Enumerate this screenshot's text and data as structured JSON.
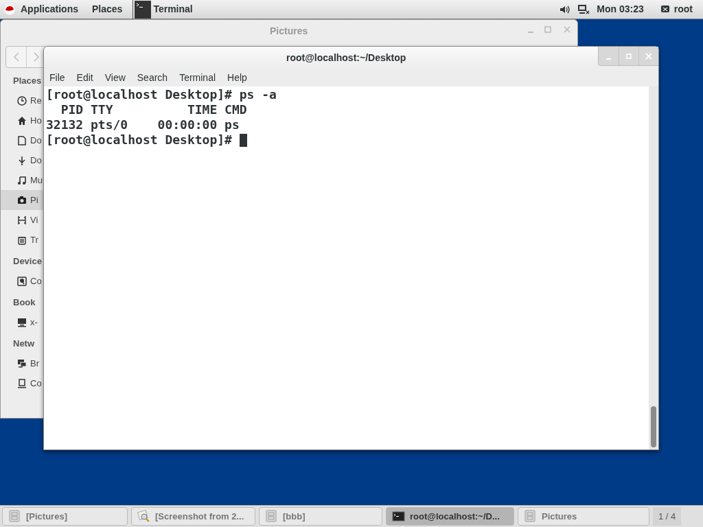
{
  "top_bar": {
    "menus": [
      "Applications",
      "Places"
    ],
    "app": "Terminal",
    "clock": "Mon 03:23",
    "user": "root"
  },
  "file_window": {
    "title": "Pictures",
    "sections": [
      {
        "title": "Places",
        "items": [
          {
            "label": "Re",
            "selected": false
          },
          {
            "label": "Ho",
            "selected": false
          },
          {
            "label": "Do",
            "selected": false
          },
          {
            "label": "Do",
            "selected": false
          },
          {
            "label": "Mu",
            "selected": false
          },
          {
            "label": "Pi",
            "selected": true
          },
          {
            "label": "Vi",
            "selected": false
          },
          {
            "label": "Tr",
            "selected": false
          }
        ]
      },
      {
        "title": "Device",
        "items": [
          {
            "label": "Co",
            "selected": false
          }
        ]
      },
      {
        "title": "Book",
        "items": [
          {
            "label": "x-",
            "selected": false
          }
        ]
      },
      {
        "title": "Netw",
        "items": [
          {
            "label": "Br",
            "selected": false
          },
          {
            "label": "Co",
            "selected": false
          }
        ]
      }
    ]
  },
  "terminal": {
    "title": "root@localhost:~/Desktop",
    "menus": [
      "File",
      "Edit",
      "View",
      "Search",
      "Terminal",
      "Help"
    ],
    "lines": [
      {
        "text": "[root@localhost Desktop]# ps -a",
        "cursor": false
      },
      {
        "text": "  PID TTY          TIME CMD",
        "cursor": false
      },
      {
        "text": "32132 pts/0    00:00:00 ps",
        "cursor": false
      },
      {
        "text": "[root@localhost Desktop]# ",
        "cursor": true
      }
    ]
  },
  "taskbar": {
    "items": [
      {
        "label": "[Pictures]",
        "kind": "folder",
        "selected": false
      },
      {
        "label": "[Screenshot from 2...",
        "kind": "viewer",
        "selected": false
      },
      {
        "label": "[bbb]",
        "kind": "folder",
        "selected": false
      },
      {
        "label": "root@localhost:~/D...",
        "kind": "terminal",
        "selected": true
      },
      {
        "label": "Pictures",
        "kind": "folder",
        "selected": false
      }
    ],
    "workspace": "1 / 4"
  }
}
